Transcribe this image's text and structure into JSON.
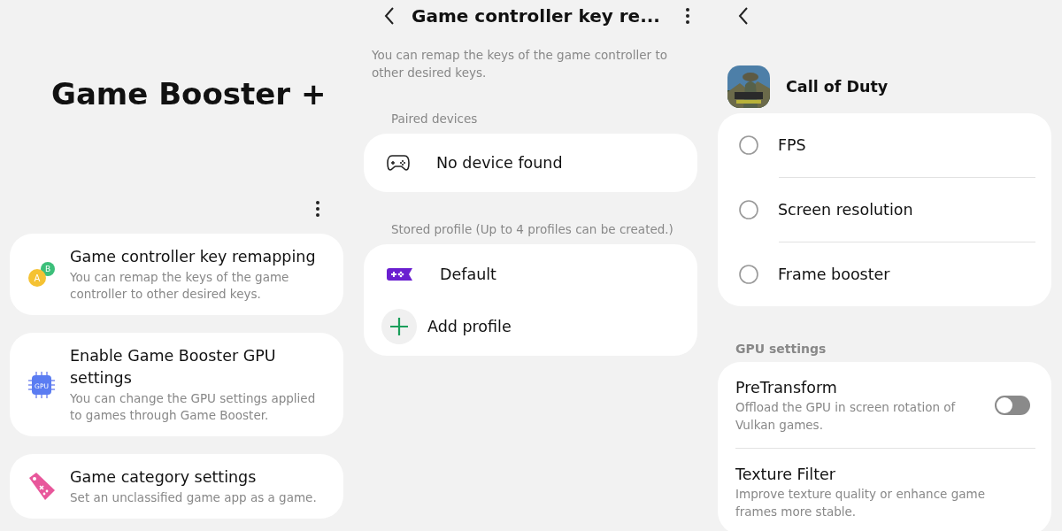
{
  "home": {
    "title": "Game Booster +",
    "items": [
      {
        "kind": "buttons",
        "icon_text": [
          "A",
          "B"
        ],
        "title": "Game controller key remapping",
        "description": "You can remap the keys of the game controller to other desired keys."
      },
      {
        "kind": "chip",
        "icon_text": [
          "GPU"
        ],
        "title": "Enable Game Booster GPU settings",
        "description": "You can change the GPU settings applied to games through Game Booster."
      },
      {
        "kind": "tag",
        "title": "Game category settings",
        "description": "Set an unclassified game app as a game."
      }
    ]
  },
  "remap": {
    "title": "Game controller key re...",
    "description": "You can remap the keys of the game controller to other desired keys.",
    "paired_label": "Paired devices",
    "devices": [
      "No device found"
    ],
    "stored_label": "Stored profile (Up to 4 profiles can be created.)",
    "profiles": [
      "Default"
    ],
    "add_label": "Add profile"
  },
  "game": {
    "app_name": "Call of Duty",
    "options": [
      {
        "label": "FPS",
        "selected": false
      },
      {
        "label": "Screen resolution",
        "selected": false
      },
      {
        "label": "Frame booster",
        "selected": false
      }
    ],
    "gpu_label": "GPU settings",
    "gpu_items": [
      {
        "kind": "toggle",
        "title": "PreTransform",
        "description": "Offload the GPU in screen rotation of Vulkan games.",
        "on": false
      },
      {
        "kind": "plain",
        "title": "Texture Filter",
        "description": "Improve texture quality or enhance game frames more stable."
      }
    ]
  }
}
